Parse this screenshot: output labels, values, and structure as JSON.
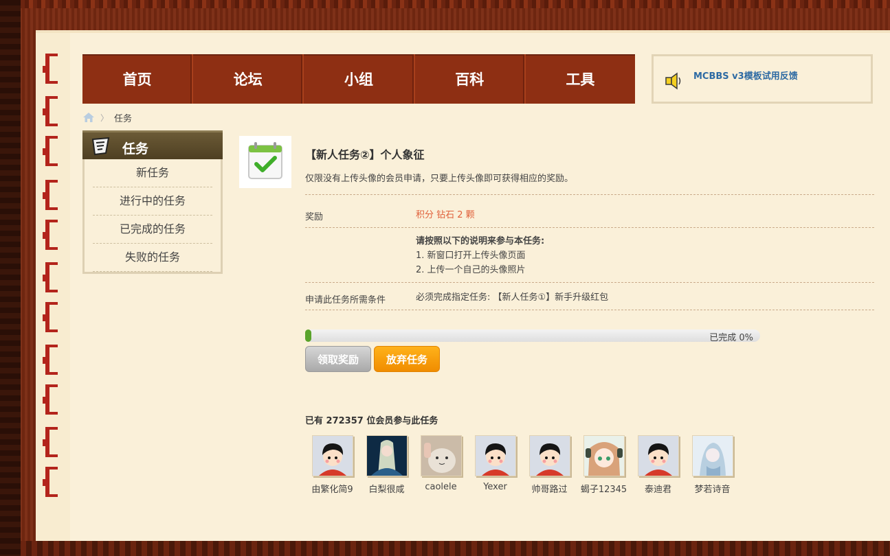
{
  "nav": {
    "items": [
      "首页",
      "论坛",
      "小组",
      "百科",
      "工具"
    ]
  },
  "notice": {
    "text": "MCBBS v3模板试用反馈"
  },
  "breadcrumb": {
    "current": "任务"
  },
  "sidebar": {
    "title": "任务",
    "items": [
      "新任务",
      "进行中的任务",
      "已完成的任务",
      "失败的任务"
    ]
  },
  "task": {
    "title": "【新人任务②】个人象征",
    "description": "仅限没有上传头像的会员申请，只要上传头像即可获得相应的奖励。",
    "reward_label": "奖励",
    "reward_value": "积分 钻石 2 颗",
    "instructions_heading": "请按照以下的说明来参与本任务:",
    "instruction_1": "1. 新窗口打开上传头像页面",
    "instruction_2": "2. 上传一个自己的头像照片",
    "condition_label": "申请此任务所需条件",
    "condition_value": "必须完成指定任务: 【新人任务①】新手升级红包",
    "progress_text": "已完成 0%",
    "progress_fraction": 0.0,
    "claim_button": "领取奖励",
    "giveup_button": "放弃任务"
  },
  "members": {
    "title": "已有 272357 位会员参与此任务",
    "list": [
      {
        "name": "由繁化简9",
        "avatar": "default-avatar"
      },
      {
        "name": "白梨很咸",
        "avatar": "photo-avatar"
      },
      {
        "name": "caolele",
        "avatar": "cat-avatar"
      },
      {
        "name": "Yexer",
        "avatar": "default-avatar"
      },
      {
        "name": "帅哥路过",
        "avatar": "default-avatar"
      },
      {
        "name": "蝎子12345",
        "avatar": "anime-avatar"
      },
      {
        "name": "泰迪君",
        "avatar": "default-avatar"
      },
      {
        "name": "梦若诗音",
        "avatar": "anime-avatar-2"
      }
    ]
  },
  "colors": {
    "nav_bg": "#8e2f13",
    "page_bg": "#faf0d9",
    "reward": "#e0603a",
    "link": "#2d6aa3",
    "progress": "#5aa32b",
    "giveup": "#f5a00a"
  }
}
